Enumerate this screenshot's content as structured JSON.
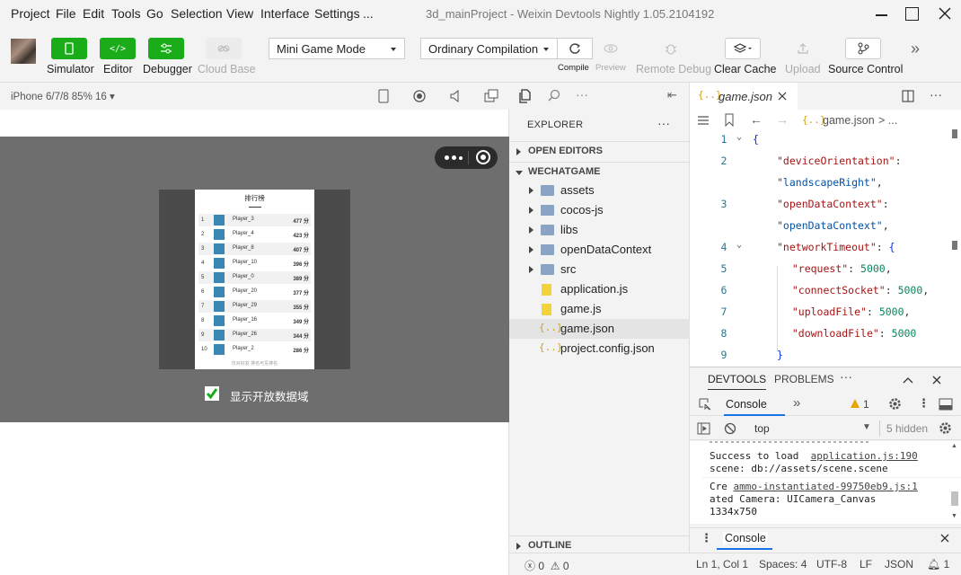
{
  "menubar": {
    "items": [
      "Project",
      "File",
      "Edit",
      "Tools",
      "Go",
      "Selection",
      "View",
      "Interface",
      "Settings",
      "..."
    ],
    "window_title": "3d_mainProject - Weixin Devtools Nightly 1.05.2104192"
  },
  "toolbar": {
    "simulator": "Simulator",
    "editor": "Editor",
    "debugger": "Debugger",
    "cloud_base": "Cloud Base",
    "mode": "Mini Game Mode",
    "compilation": "Ordinary Compilation",
    "compile": "Compile",
    "preview": "Preview",
    "remote_debug": "Remote Debug",
    "clear_cache": "Clear Cache",
    "upload": "Upload",
    "source_control": "Source Control"
  },
  "simulator": {
    "device": "iPhone 6/7/8 85% 16",
    "rank_title": "排行榜",
    "rows": [
      {
        "rank": "1",
        "name": "Player_3",
        "score": "477 分"
      },
      {
        "rank": "2",
        "name": "Player_4",
        "score": "423 分"
      },
      {
        "rank": "3",
        "name": "Player_8",
        "score": "407 分"
      },
      {
        "rank": "4",
        "name": "Player_10",
        "score": "396 分"
      },
      {
        "rank": "5",
        "name": "Player_0",
        "score": "389 分"
      },
      {
        "rank": "6",
        "name": "Player_20",
        "score": "377 分"
      },
      {
        "rank": "7",
        "name": "Player_29",
        "score": "355 分"
      },
      {
        "rank": "8",
        "name": "Player_16",
        "score": "349 分"
      },
      {
        "rank": "9",
        "name": "Player_26",
        "score": "344 分"
      },
      {
        "rank": "10",
        "name": "Player_2",
        "score": "286 分"
      }
    ],
    "footer": "仅对好友 排名可见排名",
    "checkbox_label": "显示开放数据域"
  },
  "explorer": {
    "title": "EXPLORER",
    "open_editors": "OPEN EDITORS",
    "project": "WECHATGAME",
    "items": [
      {
        "label": "assets",
        "type": "folder"
      },
      {
        "label": "cocos-js",
        "type": "folder"
      },
      {
        "label": "libs",
        "type": "folder"
      },
      {
        "label": "openDataContext",
        "type": "folder"
      },
      {
        "label": "src",
        "type": "folder"
      },
      {
        "label": "application.js",
        "type": "js"
      },
      {
        "label": "game.js",
        "type": "js"
      },
      {
        "label": "game.json",
        "type": "json"
      },
      {
        "label": "project.config.json",
        "type": "json"
      }
    ],
    "outline": "OUTLINE"
  },
  "editor": {
    "tab": "game.json",
    "breadcrumb": "game.json",
    "breadcrumb_more": "> ...",
    "lines": [
      {
        "num": "1",
        "code": "{"
      },
      {
        "num": "2",
        "code": "\"deviceOrientation\":"
      },
      {
        "num": "",
        "code": "\"landscapeRight\","
      },
      {
        "num": "3",
        "code": "\"openDataContext\":"
      },
      {
        "num": "",
        "code": "\"openDataContext\","
      },
      {
        "num": "4",
        "code": "\"networkTimeout\": {"
      },
      {
        "num": "5",
        "code": "  \"request\": 5000,"
      },
      {
        "num": "6",
        "code": "  \"connectSocket\": 5000,"
      },
      {
        "num": "7",
        "code": "  \"uploadFile\": 5000,"
      },
      {
        "num": "8",
        "code": "  \"downloadFile\": 5000"
      },
      {
        "num": "9",
        "code": "}"
      }
    ]
  },
  "devtools": {
    "tab_devtools": "DEVTOOLS",
    "tab_problems": "PROBLEMS",
    "console_tab": "Console",
    "warning_count": "1",
    "context": "top",
    "hidden": "5 hidden",
    "log_1a": "Success to load",
    "log_1_link": "application.js:190",
    "log_1b": "scene: db://assets/scene.scene",
    "log_2a": "Cre",
    "log_2_link": "ammo-instantiated-99750eb9.js:1",
    "log_2b": "ated Camera: UICamera_Canvas",
    "log_2c": "1334x750",
    "drawer_console": "Console"
  },
  "statusbar": {
    "errors": "0",
    "warnings": "0",
    "position": "Ln 1, Col 1",
    "spaces": "Spaces: 4",
    "encoding": "UTF-8",
    "eol": "LF",
    "language": "JSON",
    "notifications": "1"
  }
}
